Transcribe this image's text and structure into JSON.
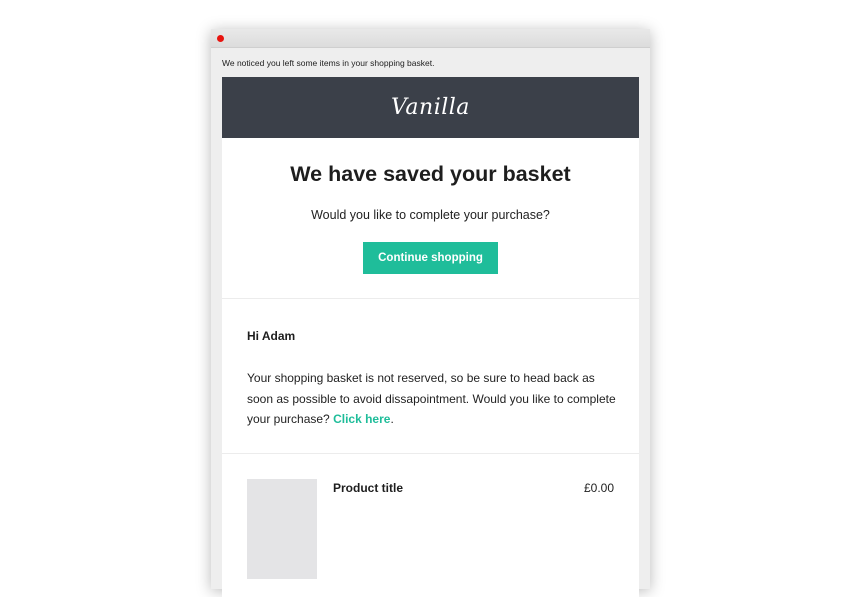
{
  "preheader": "We noticed you left some items in your shopping basket.",
  "brand": {
    "logo_text": "Vanilla",
    "header_color": "#3b4049"
  },
  "hero": {
    "title": "We have saved your basket",
    "subtitle": "Would you like to complete your purchase?",
    "cta_label": "Continue shopping"
  },
  "message": {
    "greeting": "Hi Adam",
    "body_before_link": "Your shopping basket is not reserved, so be sure to head back as soon as possible to avoid dissapointment. Would you like to complete your purchase? ",
    "link_label": "Click here",
    "body_after_link": "."
  },
  "product": {
    "title": "Product title",
    "price": "£0.00"
  },
  "colors": {
    "accent": "#1fbd9a",
    "close_button": "#e8140f"
  }
}
